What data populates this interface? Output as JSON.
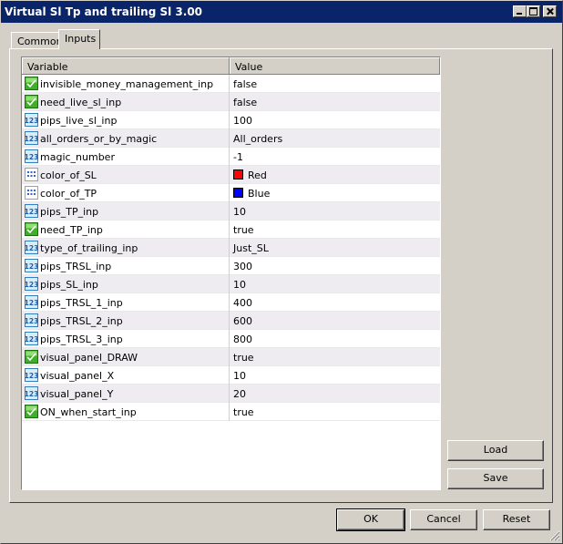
{
  "window": {
    "title": "Virtual Sl Tp and trailing Sl 3.00"
  },
  "tabs": [
    {
      "label": "Common",
      "active": false
    },
    {
      "label": "Inputs",
      "active": true
    }
  ],
  "grid": {
    "columns": [
      "Variable",
      "Value"
    ],
    "rows": [
      {
        "name": "invisible_money_management_inp",
        "value": "false",
        "icon": "bool-icon"
      },
      {
        "name": "need_live_sl_inp",
        "value": "false",
        "icon": "bool-icon"
      },
      {
        "name": "pips_live_sl_inp",
        "value": "100",
        "icon": "numeric-icon"
      },
      {
        "name": "all_orders_or_by_magic",
        "value": "All_orders",
        "icon": "numeric-icon"
      },
      {
        "name": "magic_number",
        "value": "-1",
        "icon": "numeric-icon"
      },
      {
        "name": "color_of_SL",
        "value": "Red",
        "icon": "color-icon",
        "swatch": "#ff0000"
      },
      {
        "name": "color_of_TP",
        "value": "Blue",
        "icon": "color-icon",
        "swatch": "#0000ff"
      },
      {
        "name": "pips_TP_inp",
        "value": "10",
        "icon": "numeric-icon"
      },
      {
        "name": "need_TP_inp",
        "value": "true",
        "icon": "bool-icon"
      },
      {
        "name": "type_of_trailing_inp",
        "value": "Just_SL",
        "icon": "numeric-icon"
      },
      {
        "name": "pips_TRSL_inp",
        "value": "300",
        "icon": "numeric-icon"
      },
      {
        "name": "pips_SL_inp",
        "value": "10",
        "icon": "numeric-icon"
      },
      {
        "name": "pips_TRSL_1_inp",
        "value": "400",
        "icon": "numeric-icon"
      },
      {
        "name": "pips_TRSL_2_inp",
        "value": "600",
        "icon": "numeric-icon"
      },
      {
        "name": "pips_TRSL_3_inp",
        "value": "800",
        "icon": "numeric-icon"
      },
      {
        "name": "visual_panel_DRAW",
        "value": "true",
        "icon": "bool-icon"
      },
      {
        "name": "visual_panel_X",
        "value": "10",
        "icon": "numeric-icon"
      },
      {
        "name": "visual_panel_Y",
        "value": "20",
        "icon": "numeric-icon"
      },
      {
        "name": "ON_when_start_inp",
        "value": "true",
        "icon": "bool-icon"
      }
    ]
  },
  "buttons": {
    "load": "Load",
    "save": "Save",
    "ok": "OK",
    "cancel": "Cancel",
    "reset": "Reset"
  },
  "colors": {
    "titlebar": "#0a246a",
    "face": "#d4d0c8"
  }
}
